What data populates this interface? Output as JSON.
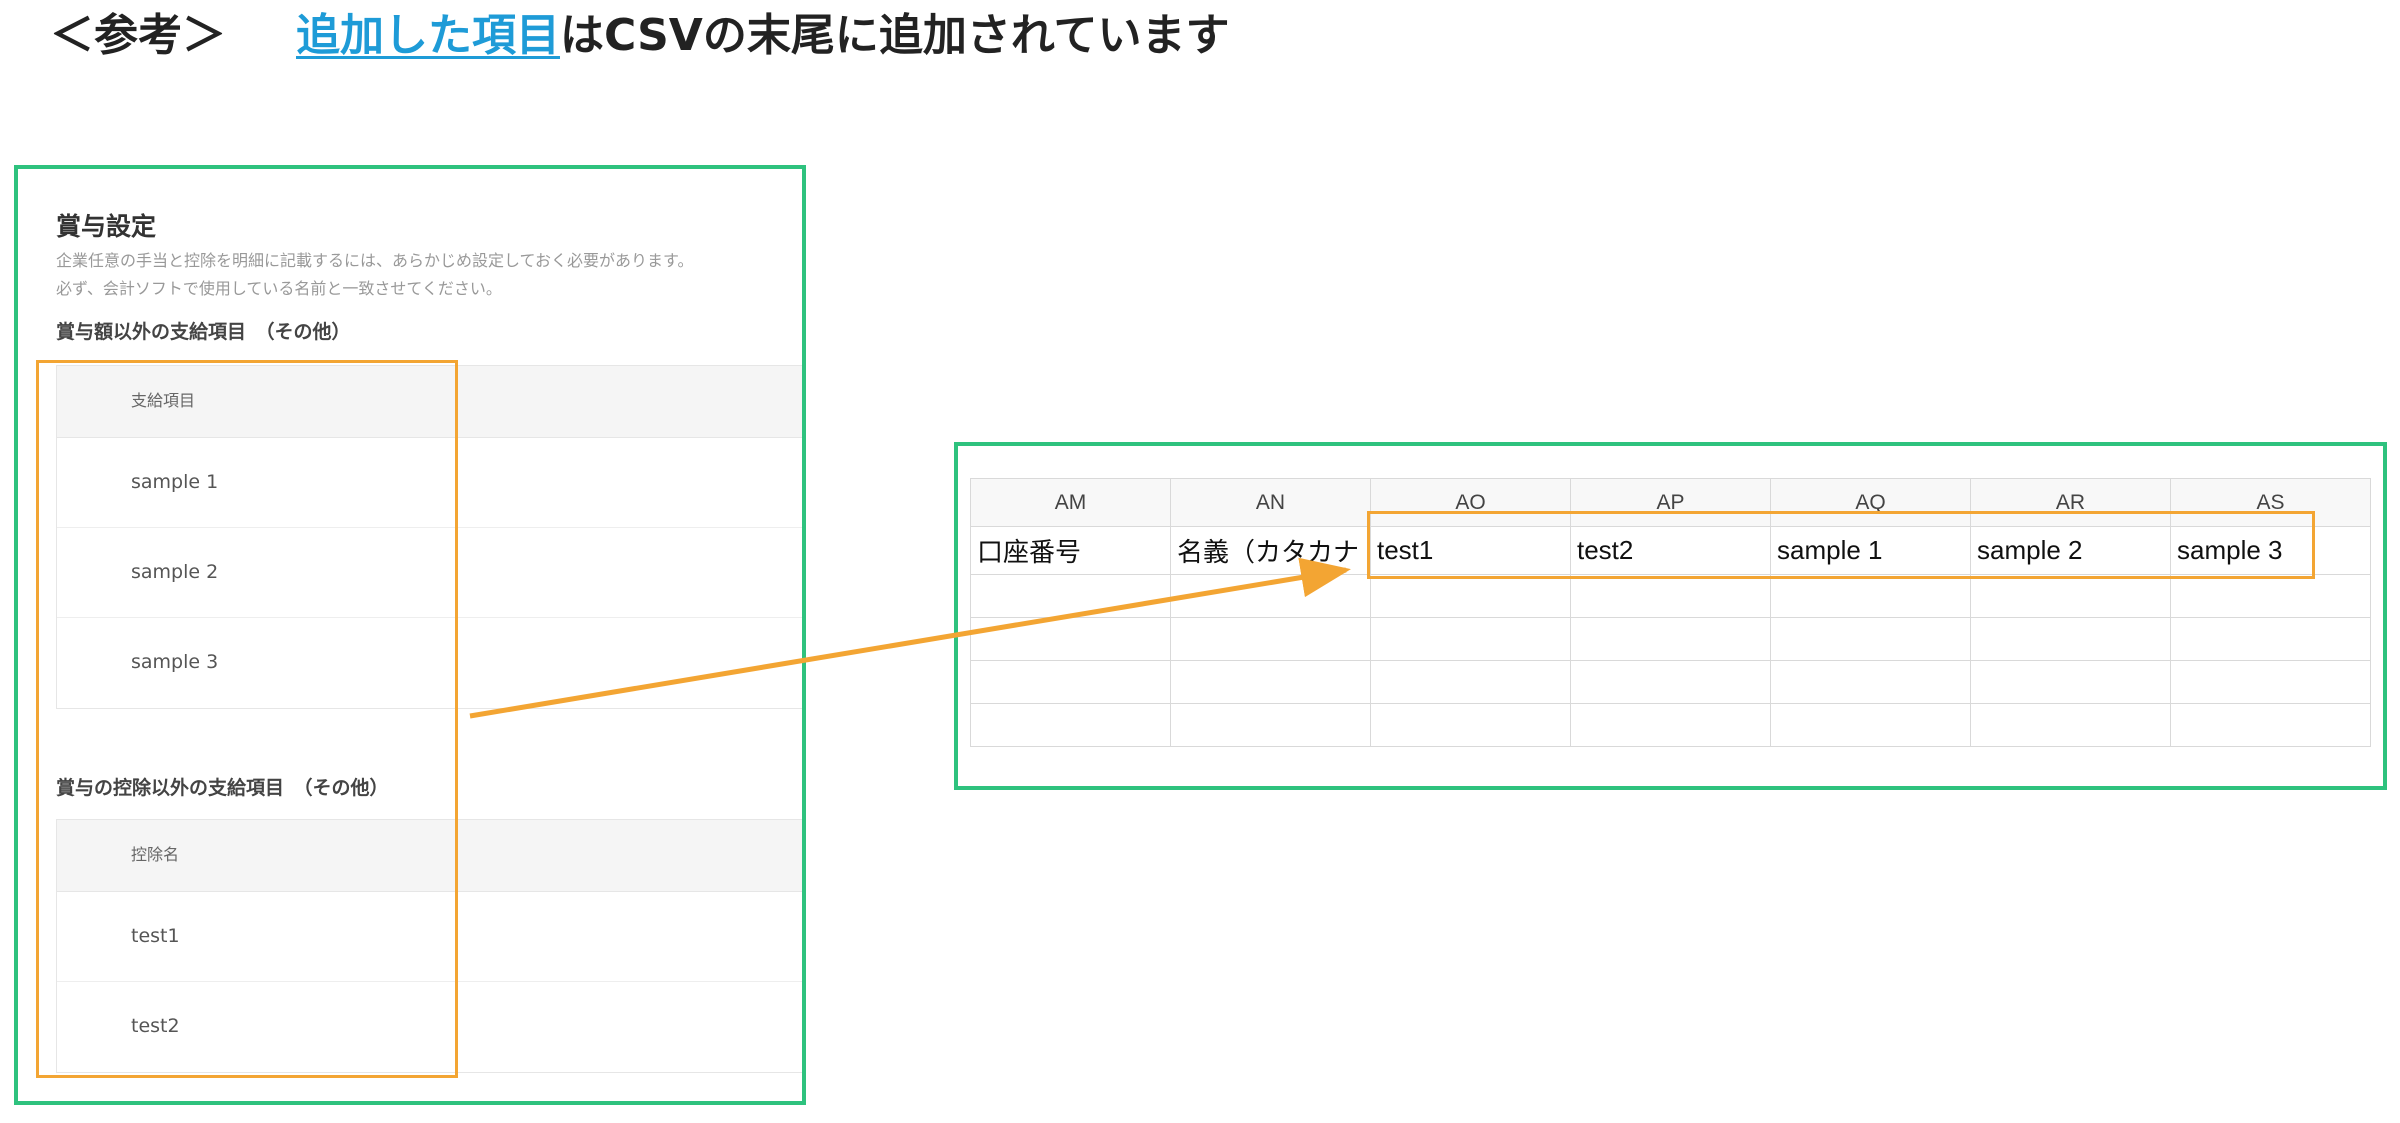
{
  "heading": {
    "prefix": "＜参考＞",
    "link": "追加した項目",
    "suffix": "はCSVの末尾に追加されています"
  },
  "bonus_settings": {
    "title": "賞与設定",
    "desc_line1": "企業任意の手当と控除を明細に記載するには、あらかじめ設定しておく必要があります。",
    "desc_line2": "必ず、会計ソフトで使用している名前と一致させてください。",
    "payment_section": "賞与額以外の支給項目　（その他）",
    "payment_header": "支給項目",
    "payment_items": [
      "sample 1",
      "sample 2",
      "sample 3"
    ],
    "deduction_section": "賞与の控除以外の支給項目　（その他）",
    "deduction_header": "控除名",
    "deduction_items": [
      "test1",
      "test2"
    ]
  },
  "spreadsheet": {
    "columns": [
      "AM",
      "AN",
      "AO",
      "AP",
      "AQ",
      "AR",
      "AS"
    ],
    "row1": [
      "口座番号",
      "名義（カタカナ",
      "test1",
      "test2",
      "sample 1",
      "sample 2",
      "sample 3"
    ]
  },
  "colors": {
    "frame": "#2ec27e",
    "highlight": "#f3a533",
    "link": "#1e9bd7"
  }
}
